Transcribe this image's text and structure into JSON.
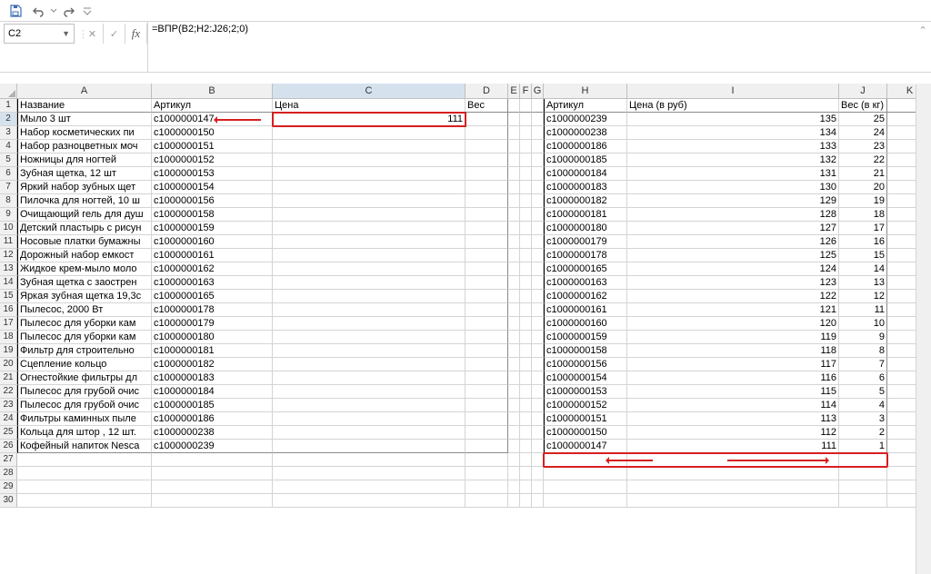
{
  "qat": {
    "save": "save",
    "undo": "undo",
    "redo": "redo"
  },
  "cell_ref": "C2",
  "formula": "=ВПР(B2;H2:J26;2;0)",
  "columns": [
    "A",
    "B",
    "C",
    "D",
    "E",
    "F",
    "G",
    "H",
    "I",
    "J",
    "K"
  ],
  "row_numbers": [
    1,
    2,
    3,
    4,
    5,
    6,
    7,
    8,
    9,
    10,
    11,
    12,
    13,
    14,
    15,
    16,
    17,
    18,
    19,
    20,
    21,
    22,
    23,
    24,
    25,
    26,
    27,
    28,
    29,
    30
  ],
  "left": {
    "headers": {
      "a": "Название",
      "b": "Артикул",
      "c": "Цена",
      "d": "Вес"
    },
    "rows": [
      {
        "a": "Мыло 3 шт",
        "b": "с1000000147",
        "c": "111",
        "d": ""
      },
      {
        "a": "Набор косметических пи",
        "b": "с1000000150",
        "c": "",
        "d": ""
      },
      {
        "a": "Набор разноцветных моч",
        "b": "с1000000151",
        "c": "",
        "d": ""
      },
      {
        "a": "Ножницы для ногтей",
        "b": "с1000000152",
        "c": "",
        "d": ""
      },
      {
        "a": "Зубная щетка, 12 шт",
        "b": "с1000000153",
        "c": "",
        "d": ""
      },
      {
        "a": "Яркий набор зубных щет",
        "b": "с1000000154",
        "c": "",
        "d": ""
      },
      {
        "a": "Пилочка для ногтей, 10 ш",
        "b": "с1000000156",
        "c": "",
        "d": ""
      },
      {
        "a": "Очищающий гель для душ",
        "b": "с1000000158",
        "c": "",
        "d": ""
      },
      {
        "a": "Детский пластырь с рисун",
        "b": "с1000000159",
        "c": "",
        "d": ""
      },
      {
        "a": "Носовые платки бумажны",
        "b": "с1000000160",
        "c": "",
        "d": ""
      },
      {
        "a": "Дорожный набор емкост",
        "b": "с1000000161",
        "c": "",
        "d": ""
      },
      {
        "a": "Жидкое крем-мыло моло",
        "b": "с1000000162",
        "c": "",
        "d": ""
      },
      {
        "a": "Зубная щетка с заострен",
        "b": "с1000000163",
        "c": "",
        "d": ""
      },
      {
        "a": "Яркая зубная щетка 19,3с",
        "b": "с1000000165",
        "c": "",
        "d": ""
      },
      {
        "a": "Пылесос, 2000 Вт",
        "b": "с1000000178",
        "c": "",
        "d": ""
      },
      {
        "a": "Пылесос для уборки кам",
        "b": "с1000000179",
        "c": "",
        "d": ""
      },
      {
        "a": "Пылесос для уборки кам",
        "b": "с1000000180",
        "c": "",
        "d": ""
      },
      {
        "a": "Фильтр для строительно",
        "b": "с1000000181",
        "c": "",
        "d": ""
      },
      {
        "a": "Сцепление кольцо",
        "b": "с1000000182",
        "c": "",
        "d": ""
      },
      {
        "a": "Огнестойкие фильтры дл",
        "b": "с1000000183",
        "c": "",
        "d": ""
      },
      {
        "a": "Пылесос для грубой очис",
        "b": "с1000000184",
        "c": "",
        "d": ""
      },
      {
        "a": "Пылесос для грубой очис",
        "b": "с1000000185",
        "c": "",
        "d": ""
      },
      {
        "a": "Фильтры каминных пыле",
        "b": "с1000000186",
        "c": "",
        "d": ""
      },
      {
        "a": "Кольца для штор , 12 шт.",
        "b": "с1000000238",
        "c": "",
        "d": ""
      },
      {
        "a": "Кофейный напиток Nesca",
        "b": "с1000000239",
        "c": "",
        "d": ""
      }
    ]
  },
  "right": {
    "headers": {
      "h": "Артикул",
      "i": "Цена (в руб)",
      "j": "Вес (в кг)"
    },
    "rows": [
      {
        "h": "с1000000239",
        "i": "135",
        "j": "25"
      },
      {
        "h": "с1000000238",
        "i": "134",
        "j": "24"
      },
      {
        "h": "с1000000186",
        "i": "133",
        "j": "23"
      },
      {
        "h": "с1000000185",
        "i": "132",
        "j": "22"
      },
      {
        "h": "с1000000184",
        "i": "131",
        "j": "21"
      },
      {
        "h": "с1000000183",
        "i": "130",
        "j": "20"
      },
      {
        "h": "с1000000182",
        "i": "129",
        "j": "19"
      },
      {
        "h": "с1000000181",
        "i": "128",
        "j": "18"
      },
      {
        "h": "с1000000180",
        "i": "127",
        "j": "17"
      },
      {
        "h": "с1000000179",
        "i": "126",
        "j": "16"
      },
      {
        "h": "с1000000178",
        "i": "125",
        "j": "15"
      },
      {
        "h": "с1000000165",
        "i": "124",
        "j": "14"
      },
      {
        "h": "с1000000163",
        "i": "123",
        "j": "13"
      },
      {
        "h": "с1000000162",
        "i": "122",
        "j": "12"
      },
      {
        "h": "с1000000161",
        "i": "121",
        "j": "11"
      },
      {
        "h": "с1000000160",
        "i": "120",
        "j": "10"
      },
      {
        "h": "с1000000159",
        "i": "119",
        "j": "9"
      },
      {
        "h": "с1000000158",
        "i": "118",
        "j": "8"
      },
      {
        "h": "с1000000156",
        "i": "117",
        "j": "7"
      },
      {
        "h": "с1000000154",
        "i": "116",
        "j": "6"
      },
      {
        "h": "с1000000153",
        "i": "115",
        "j": "5"
      },
      {
        "h": "с1000000152",
        "i": "114",
        "j": "4"
      },
      {
        "h": "с1000000151",
        "i": "113",
        "j": "3"
      },
      {
        "h": "с1000000150",
        "i": "112",
        "j": "2"
      },
      {
        "h": "с1000000147",
        "i": "111",
        "j": "1"
      }
    ]
  }
}
